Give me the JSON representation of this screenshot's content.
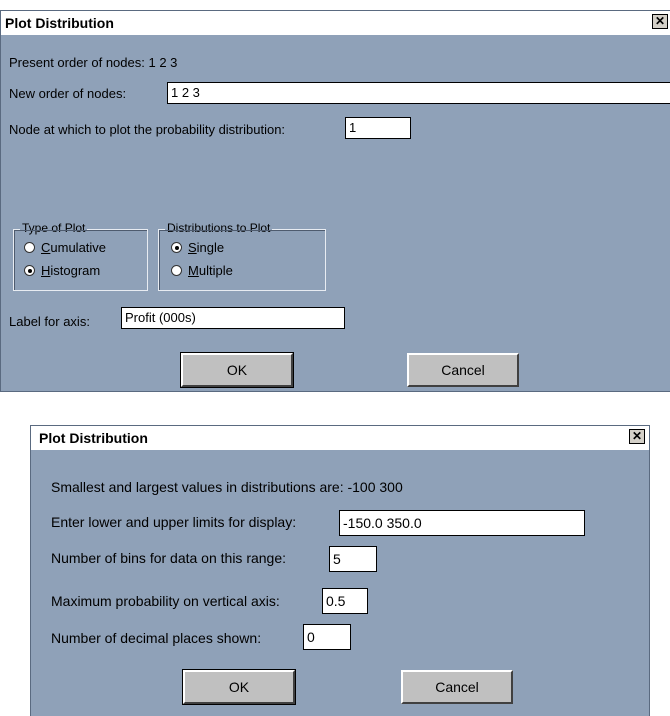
{
  "dialog1": {
    "title": "Plot Distribution",
    "close_glyph": "✕",
    "present_order_label": "Present order of nodes: 1 2 3",
    "new_order_label": "New order of nodes:",
    "new_order_value": "1 2 3",
    "node_label": "Node at which to plot the probability distribution:",
    "node_value": "1",
    "type_group_label": "Type of Plot",
    "type_options": [
      {
        "hotkey": "C",
        "rest": "umulative",
        "selected": false
      },
      {
        "hotkey": "H",
        "rest": "istogram",
        "selected": true
      }
    ],
    "dist_group_label": "Distributions to Plot",
    "dist_options": [
      {
        "hotkey": "S",
        "rest": "ingle",
        "selected": true
      },
      {
        "hotkey": "M",
        "rest": "ultiple",
        "selected": false
      }
    ],
    "axis_label": "Label for axis:",
    "axis_value": "Profit (000s)",
    "ok_label": "OK",
    "cancel_label": "Cancel"
  },
  "dialog2": {
    "title": "Plot Distribution",
    "close_glyph": "✕",
    "range_info": "Smallest and largest values in distributions are: -100 300",
    "limits_label": "Enter lower and upper limits for display:",
    "limits_value": "-150.0 350.0",
    "bins_label": "Number of bins for data on this range:",
    "bins_value": "5",
    "maxprob_label": "Maximum probability on vertical axis:",
    "maxprob_value": "0.5",
    "decimals_label": "Number of decimal places shown:",
    "decimals_value": "0",
    "ok_label": "OK",
    "cancel_label": "Cancel"
  }
}
